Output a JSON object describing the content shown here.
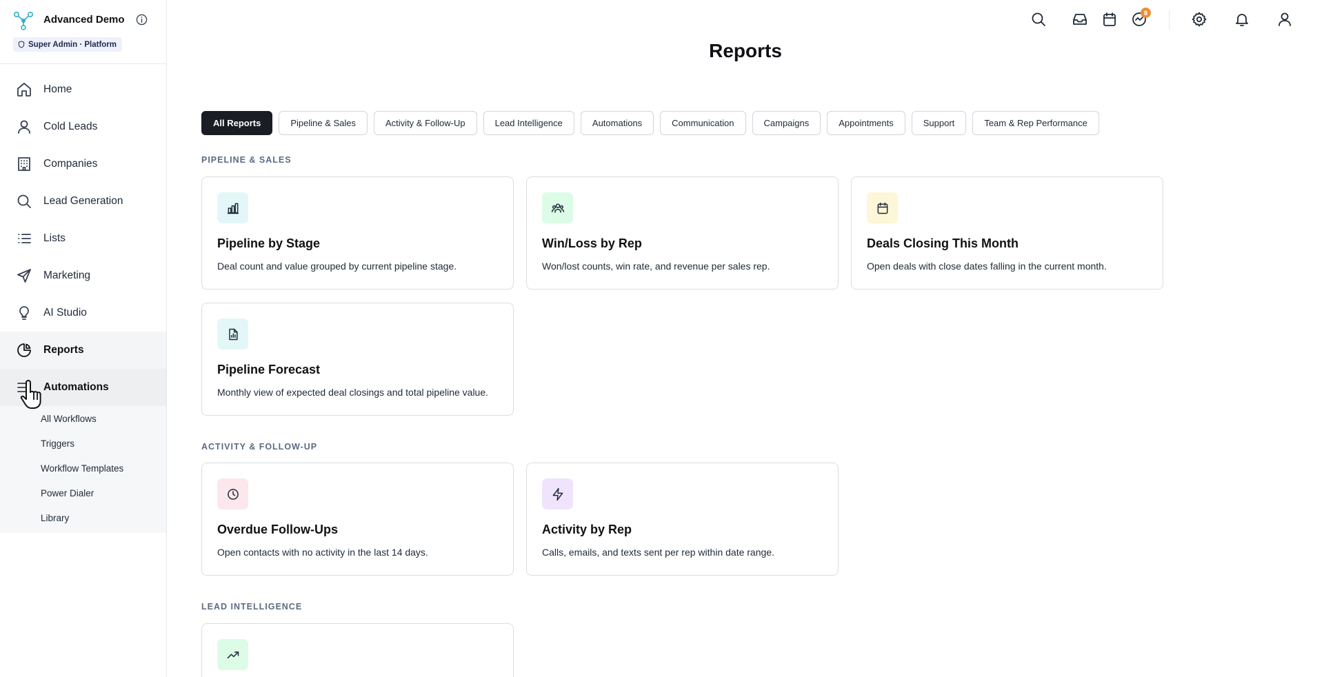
{
  "brand": {
    "name": "Advanced Demo",
    "badge": "Super Admin · Platform"
  },
  "sidebar": {
    "items": [
      {
        "label": "Home",
        "icon": "home-icon"
      },
      {
        "label": "Cold Leads",
        "icon": "user-icon"
      },
      {
        "label": "Companies",
        "icon": "building-icon"
      },
      {
        "label": "Lead Generation",
        "icon": "search-icon"
      },
      {
        "label": "Lists",
        "icon": "list-icon"
      },
      {
        "label": "Marketing",
        "icon": "send-icon"
      },
      {
        "label": "AI Studio",
        "icon": "lightbulb-icon"
      },
      {
        "label": "Reports",
        "icon": "pie-chart-icon"
      },
      {
        "label": "Automations",
        "icon": "sliders-icon"
      }
    ],
    "sub_items": [
      "All Workflows",
      "Triggers",
      "Workflow Templates",
      "Power Dialer",
      "Library"
    ]
  },
  "topbar": {
    "notification_count": "8"
  },
  "page": {
    "title": "Reports"
  },
  "tabs": [
    "All Reports",
    "Pipeline & Sales",
    "Activity & Follow-Up",
    "Lead Intelligence",
    "Automations",
    "Communication",
    "Campaigns",
    "Appointments",
    "Support",
    "Team & Rep Performance"
  ],
  "sections": [
    {
      "label": "Pipeline & Sales",
      "cards": [
        {
          "title": "Pipeline by Stage",
          "desc": "Deal count and value grouped by current pipeline stage.",
          "icon": "bar-chart-icon",
          "color": "#e3f7f8"
        },
        {
          "title": "Win/Loss by Rep",
          "desc": "Won/lost counts, win rate, and revenue per sales rep.",
          "icon": "users-icon",
          "color": "#dcfce7"
        },
        {
          "title": "Deals Closing This Month",
          "desc": "Open deals with close dates falling in the current month.",
          "icon": "calendar-icon",
          "color": "#fdf6d8"
        },
        {
          "title": "Pipeline Forecast",
          "desc": "Monthly view of expected deal closings and total pipeline value.",
          "icon": "file-chart-icon",
          "color": "#e3f7f8"
        }
      ]
    },
    {
      "label": "Activity & Follow-Up",
      "cards": [
        {
          "title": "Overdue Follow-Ups",
          "desc": "Open contacts with no activity in the last 14 days.",
          "icon": "clock-icon",
          "color": "#fce7ec"
        },
        {
          "title": "Activity by Rep",
          "desc": "Calls, emails, and texts sent per rep within date range.",
          "icon": "bolt-icon",
          "color": "#efe4fc"
        }
      ]
    },
    {
      "label": "Lead Intelligence",
      "cards": [
        {
          "title": "",
          "desc": "",
          "icon": "trending-up-icon",
          "color": "#dcfce7"
        }
      ]
    }
  ]
}
